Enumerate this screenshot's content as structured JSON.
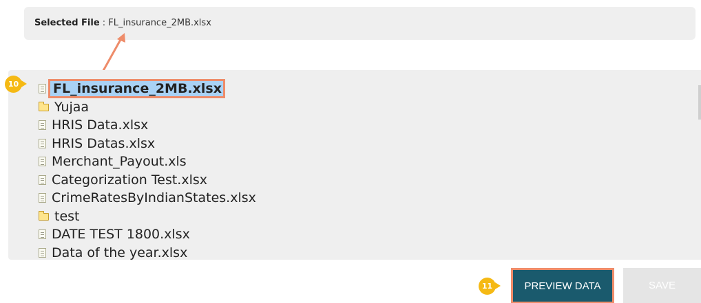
{
  "selected_file": {
    "label": "Selected File",
    "separator": " : ",
    "value": "FL_insurance_2MB.xlsx"
  },
  "annotations": {
    "step_file": "10",
    "step_preview": "11",
    "accent_color": "#ee8c6a",
    "badge_color": "#f5b914"
  },
  "files": [
    {
      "name": "FL_insurance_2MB.xlsx",
      "type": "file",
      "icon": "document-icon",
      "selected": true
    },
    {
      "name": "Yujaa",
      "type": "folder",
      "icon": "folder-icon"
    },
    {
      "name": "HRIS Data.xlsx",
      "type": "file",
      "icon": "document-icon"
    },
    {
      "name": "HRIS Datas.xlsx",
      "type": "file",
      "icon": "document-icon"
    },
    {
      "name": "Merchant_Payout.xls",
      "type": "file",
      "icon": "document-icon"
    },
    {
      "name": "Categorization Test.xlsx",
      "type": "file",
      "icon": "document-icon"
    },
    {
      "name": "CrimeRatesByIndianStates.xlsx",
      "type": "file",
      "icon": "document-icon"
    },
    {
      "name": "test",
      "type": "folder",
      "icon": "folder-icon"
    },
    {
      "name": "DATE TEST 1800.xlsx",
      "type": "file",
      "icon": "document-icon"
    },
    {
      "name": "Data of the year.xlsx",
      "type": "file",
      "icon": "document-icon"
    }
  ],
  "buttons": {
    "preview_label": "PREVIEW DATA",
    "save_label": "SAVE",
    "preview_color": "#1a5a6d"
  }
}
